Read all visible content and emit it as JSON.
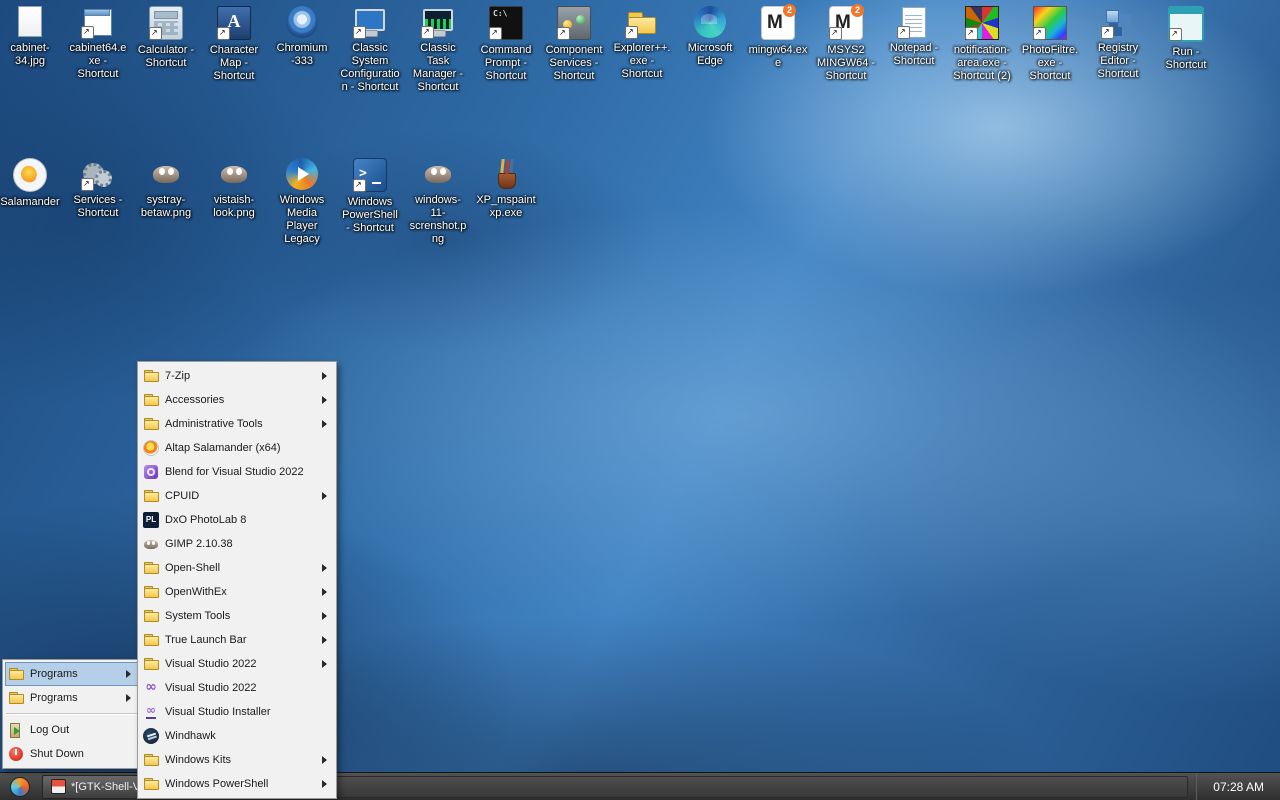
{
  "colors": {
    "wallpaper_blue": "#2f6ba6",
    "menu_background": "#f1f1f1",
    "menu_selection_blue": "#b6cfe8",
    "taskbar_gray": "#3a3a3a",
    "desktop_label_text": "#ffffff"
  },
  "desktop": {
    "rows": [
      {
        "icons": [
          {
            "label": "cabinet-34.jpg",
            "icon": "image-file",
            "shortcut": false
          },
          {
            "label": "cabinet64.exe - Shortcut",
            "icon": "app-window",
            "shortcut": true
          },
          {
            "label": "Calculator - Shortcut",
            "icon": "calculator",
            "shortcut": true
          },
          {
            "label": "Character Map - Shortcut",
            "icon": "charmap",
            "shortcut": true
          },
          {
            "label": "Chromium -333",
            "icon": "chromium",
            "shortcut": false
          },
          {
            "label": "Classic System Configuration - Shortcut",
            "icon": "sysconfig",
            "shortcut": true
          },
          {
            "label": "Classic Task Manager - Shortcut",
            "icon": "taskmgr",
            "shortcut": true
          },
          {
            "label": "Command Prompt - Shortcut",
            "icon": "cmd",
            "shortcut": true
          },
          {
            "label": "Component Services - Shortcut",
            "icon": "component-services",
            "shortcut": true
          },
          {
            "label": "Explorer++.exe - Shortcut",
            "icon": "folder",
            "shortcut": true
          },
          {
            "label": "Microsoft Edge",
            "icon": "edge",
            "shortcut": false
          },
          {
            "label": "mingw64.exe",
            "icon": "m2",
            "shortcut": false
          },
          {
            "label": "MSYS2 MINGW64 - Shortcut",
            "icon": "m2",
            "shortcut": true
          },
          {
            "label": "Notepad - Shortcut",
            "icon": "notepad",
            "shortcut": true
          },
          {
            "label": "notification-area.exe - Shortcut (2)",
            "icon": "pixel-noise",
            "shortcut": true
          },
          {
            "label": "PhotoFiltre.exe - Shortcut",
            "icon": "photofiltre",
            "shortcut": true
          },
          {
            "label": "Registry Editor - Shortcut",
            "icon": "regedit",
            "shortcut": true
          },
          {
            "label": "Run - Shortcut",
            "icon": "run",
            "shortcut": true
          }
        ]
      },
      {
        "icons": [
          {
            "label": "Salamander",
            "icon": "salamander",
            "shortcut": false
          },
          {
            "label": "Services - Shortcut",
            "icon": "services",
            "shortcut": true
          },
          {
            "label": "systray-betaw.png",
            "icon": "gimp-image",
            "shortcut": false
          },
          {
            "label": "vistaish-look.png",
            "icon": "gimp-image",
            "shortcut": false
          },
          {
            "label": "Windows Media Player Legacy",
            "icon": "wmp",
            "shortcut": false
          },
          {
            "label": "Windows PowerShell - Shortcut",
            "icon": "powershell",
            "shortcut": true
          },
          {
            "label": "windows-11-screnshot.png",
            "icon": "gimp-image",
            "shortcut": false
          },
          {
            "label": "XP_mspaintxp.exe",
            "icon": "paint-cup",
            "shortcut": false
          }
        ]
      }
    ]
  },
  "start_menu": {
    "items": [
      {
        "label": "Programs",
        "icon": "folder",
        "submenu": true,
        "selected": true
      },
      {
        "label": "Programs",
        "icon": "folder",
        "submenu": true,
        "selected": false
      },
      {
        "type": "separator"
      },
      {
        "label": "Log Out",
        "icon": "logout",
        "submenu": false,
        "selected": false
      },
      {
        "label": "Shut Down",
        "icon": "shutdown",
        "submenu": false,
        "selected": false
      }
    ]
  },
  "programs_menu": {
    "items": [
      {
        "label": "7-Zip",
        "icon": "folder",
        "submenu": true
      },
      {
        "label": "Accessories",
        "icon": "folder",
        "submenu": true
      },
      {
        "label": "Administrative Tools",
        "icon": "folder",
        "submenu": true
      },
      {
        "label": "Altap Salamander (x64)",
        "icon": "salamander",
        "submenu": false
      },
      {
        "label": "Blend for Visual Studio 2022",
        "icon": "blend",
        "submenu": false
      },
      {
        "label": "CPUID",
        "icon": "folder",
        "submenu": true
      },
      {
        "label": "DxO PhotoLab 8",
        "icon": "photolab",
        "submenu": false
      },
      {
        "label": "GIMP 2.10.38",
        "icon": "gimp",
        "submenu": false
      },
      {
        "label": "Open-Shell",
        "icon": "folder",
        "submenu": true
      },
      {
        "label": "OpenWithEx",
        "icon": "folder",
        "submenu": true
      },
      {
        "label": "System Tools",
        "icon": "folder",
        "submenu": true
      },
      {
        "label": "True Launch Bar",
        "icon": "folder",
        "submenu": true
      },
      {
        "label": "Visual Studio 2022",
        "icon": "folder",
        "submenu": true
      },
      {
        "label": "Visual Studio 2022",
        "icon": "visual-studio",
        "submenu": false
      },
      {
        "label": "Visual Studio Installer",
        "icon": "vs-installer",
        "submenu": false
      },
      {
        "label": "Windhawk",
        "icon": "windhawk",
        "submenu": false
      },
      {
        "label": "Windows Kits",
        "icon": "folder",
        "submenu": true
      },
      {
        "label": "Windows PowerShell",
        "icon": "folder",
        "submenu": true
      }
    ]
  },
  "taskbar": {
    "task_button_label": "*[GTK-Shell-Vi...",
    "clock": "07:28 AM"
  }
}
